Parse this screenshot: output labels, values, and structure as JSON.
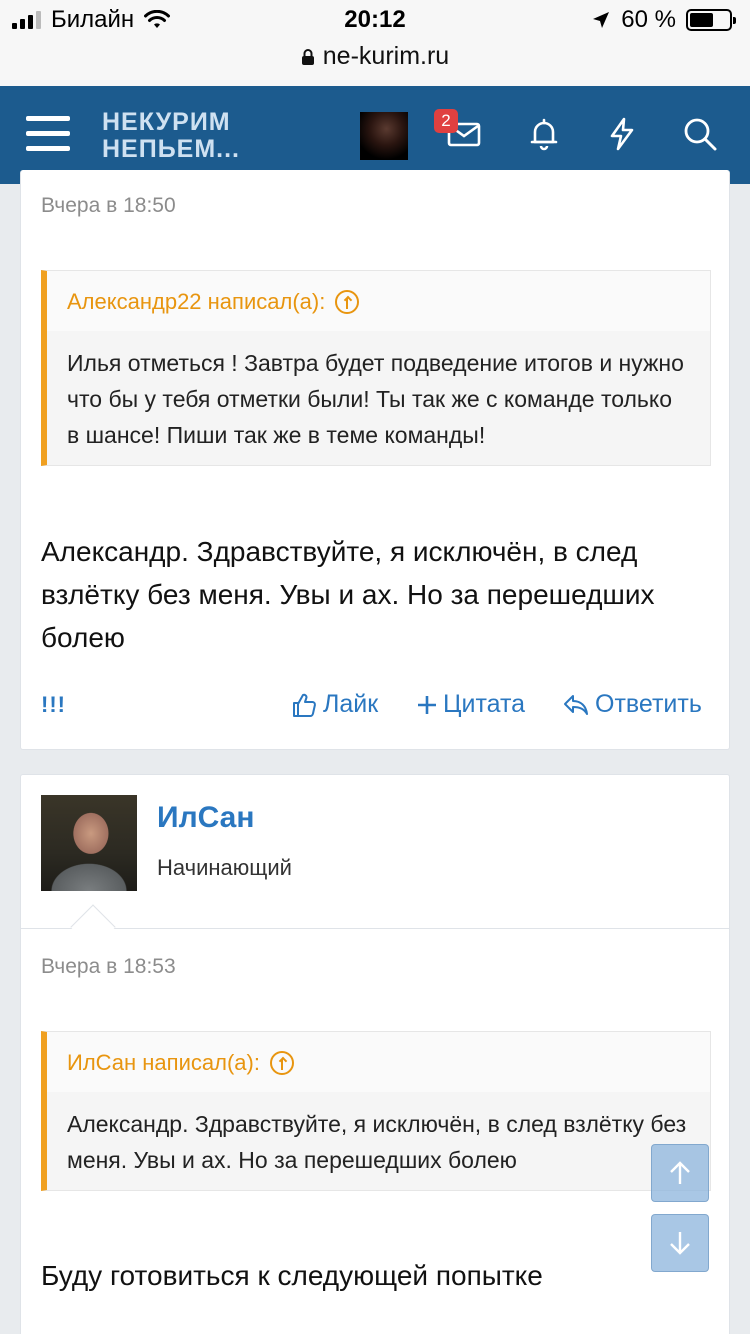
{
  "status_bar": {
    "carrier": "Билайн",
    "time": "20:12",
    "battery_text": "60 %",
    "battery_level": 0.6
  },
  "browser": {
    "url": "ne-kurim.ru"
  },
  "header": {
    "logo_line1": "НЕКУРИМ",
    "logo_line2": "НЕПЬЕМ...",
    "messages_badge": "2",
    "accent_color": "#1c5b8e"
  },
  "post1": {
    "date": "Вчера в 18:50",
    "quote_author": "Александр22 написал(а):",
    "quote_text": "Илья отметься ! Завтра будет подведение итогов и нужно что бы у тебя отметки были! Ты так же с команде только в шансе! Пиши так же в теме команды!",
    "message": "Александр. Здравствуйте, я исключён, в след взлётку без меня. Увы и ах. Но за перешедших болею",
    "report_label": "!!!",
    "like_label": "Лайк",
    "quote_label": "Цитата",
    "reply_label": "Ответить"
  },
  "post2": {
    "username": "ИлСан",
    "user_title": "Начинающий",
    "date": "Вчера в 18:53",
    "quote_author": "ИлСан написал(а):",
    "quote_text": "Александр. Здравствуйте, я исключён, в след взлётку без меня. Увы и ах. Но за перешедших болею",
    "message": "Буду готовиться к следующей попытке"
  },
  "colors": {
    "link": "#2a77c0",
    "quote_accent": "#f0a020"
  }
}
